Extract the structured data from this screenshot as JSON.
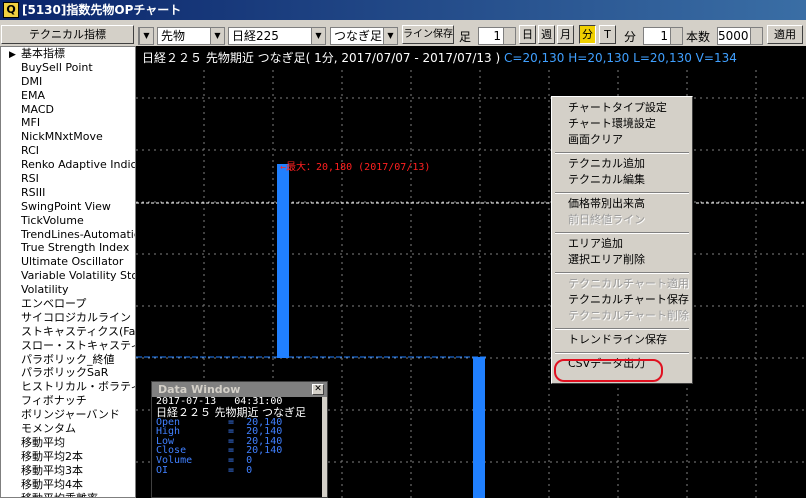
{
  "window": {
    "title": "[5130]指数先物OPチャート"
  },
  "toolbar": {
    "technical_label": "テクニカル指標",
    "combo_market": "先物",
    "combo_index": "日経225",
    "combo_type": "つなぎ足",
    "line_save_label": "ライン保存",
    "foot_label": "足",
    "foot_value": "1",
    "day_label": "日",
    "week_label": "週",
    "month_label": "月",
    "minute_btn_label": "分",
    "tick_label": "T",
    "minute_label": "分",
    "minute_value": "1",
    "count_label": "本数",
    "count_value": "5000",
    "apply_label": "適用"
  },
  "sidebar": {
    "items": [
      "基本指標",
      "BuySell Point",
      "DMI",
      "EMA",
      "MACD",
      "MFI",
      "NickMNxtMove",
      "RCI",
      "Renko Adaptive Indica",
      "RSI",
      "RSIII",
      "SwingPoint View",
      "TickVolume",
      "TrendLines-Automatic",
      "True Strength Index",
      "Ultimate Oscillator",
      "Variable Volatility Stop",
      "Volatility",
      "エンベロープ",
      "サイコロジカルライン",
      "ストキャスティクス(Fas",
      "スロー・ストキャスティク",
      "パラボリック_終値",
      "パラボリックSaR",
      "ヒストリカル・ボラティリ",
      "フィボナッチ",
      "ボリンジャーバンド",
      "モメンタム",
      "移動平均",
      "移動平均2本",
      "移動平均3本",
      "移動平均4本",
      "移動平均乖離率"
    ]
  },
  "chart": {
    "header_main": "日経２２５ 先物期近 つなぎ足( 1分, 2017/07/07 - 2017/07/13 )",
    "header_ohlc": "C=20,130 H=20,130 L=20,130 V=134",
    "max_label": "←最大：20,180 (2017/07/13)",
    "colors": {
      "background": "#000000",
      "bar": "#2080ff",
      "grid": "#808080",
      "max_label": "#ff2020",
      "ref_line": "#ffffff"
    }
  },
  "context_menu": {
    "items": [
      {
        "label": "チャートタイプ設定",
        "enabled": true
      },
      {
        "label": "チャート環境設定",
        "enabled": true
      },
      {
        "label": "画面クリア",
        "enabled": true
      },
      {
        "sep": true
      },
      {
        "label": "テクニカル追加",
        "enabled": true
      },
      {
        "label": "テクニカル編集",
        "enabled": true
      },
      {
        "sep": true
      },
      {
        "label": "価格帯別出来高",
        "enabled": true
      },
      {
        "label": "前日終値ライン",
        "enabled": false
      },
      {
        "sep": true
      },
      {
        "label": "エリア追加",
        "enabled": true
      },
      {
        "label": "選択エリア削除",
        "enabled": true
      },
      {
        "sep": true
      },
      {
        "label": "テクニカルチャート適用",
        "enabled": false
      },
      {
        "label": "テクニカルチャート保存",
        "enabled": true
      },
      {
        "label": "テクニカルチャート削除",
        "enabled": false
      },
      {
        "sep": true
      },
      {
        "label": "トレンドライン保存",
        "enabled": true
      },
      {
        "sep": true
      },
      {
        "label": "CSVデータ出力",
        "enabled": true,
        "highlighted": true
      }
    ]
  },
  "data_window": {
    "title": "Data Window",
    "datetime": "2017-07-13   04:31:00",
    "instrument": "日経２２５ 先物期近 つなぎ足",
    "rows": [
      {
        "key": "Open",
        "value": "20,140"
      },
      {
        "key": "High",
        "value": "20,140"
      },
      {
        "key": "Low",
        "value": "20,140"
      },
      {
        "key": "Close",
        "value": "20,140"
      },
      {
        "key": "Volume",
        "value": "0"
      },
      {
        "key": "OI",
        "value": "0"
      }
    ]
  }
}
